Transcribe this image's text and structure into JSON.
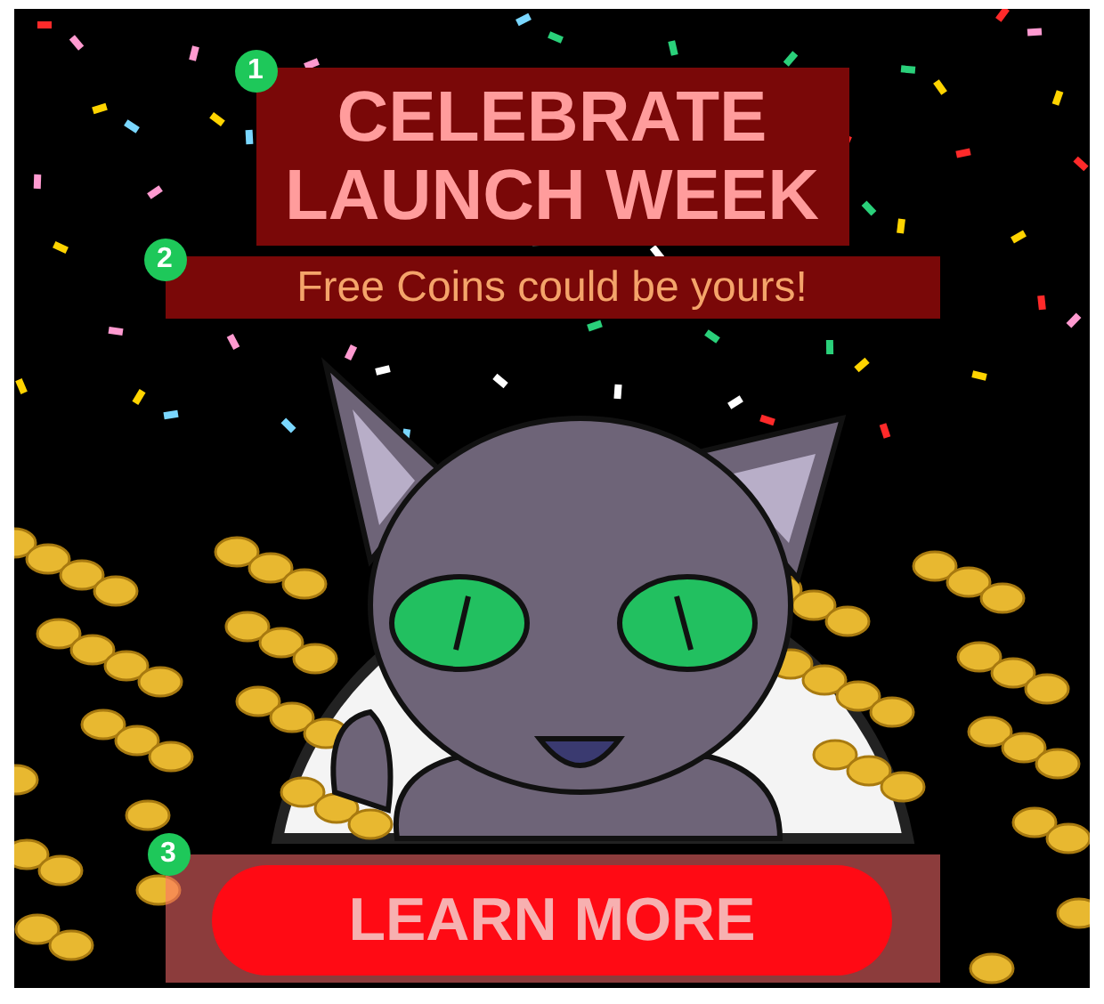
{
  "headline": {
    "lines": [
      "CELEBRATE",
      "LAUNCH WEEK"
    ],
    "marker": "1"
  },
  "subheadline": {
    "text": "Free Coins could be yours!",
    "marker": "2"
  },
  "button": {
    "label": "LEARN MORE",
    "marker": "3"
  }
}
